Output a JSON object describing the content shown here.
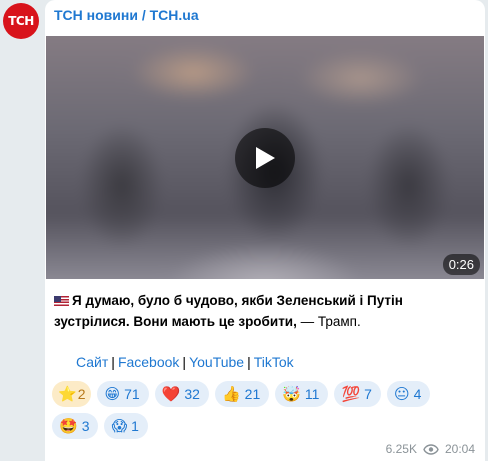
{
  "channel": {
    "avatar_text": "ТСН",
    "name": "ТСН новини / TCH.ua"
  },
  "video": {
    "duration": "0:26"
  },
  "post": {
    "text_bold": "Я думаю, було б чудово, якби Зеленський і Путін зустрілися. Вони мають це зробити,",
    "text_rest": " — Трамп."
  },
  "links": {
    "site": "Сайт",
    "facebook": "Facebook",
    "youtube": "YouTube",
    "tiktok": "TikTok",
    "separator": "|"
  },
  "reactions": [
    {
      "icon": "⭐",
      "name": "star-reaction",
      "count": "2"
    },
    {
      "icon": "😁",
      "name": "grin-reaction",
      "count": "71"
    },
    {
      "icon": "❤️",
      "name": "heart-reaction",
      "count": "32"
    },
    {
      "icon": "👍",
      "name": "thumbs-up-reaction",
      "count": "21"
    },
    {
      "icon": "🤯",
      "name": "mind-blown-reaction",
      "count": "11"
    },
    {
      "icon": "💯",
      "name": "hundred-reaction",
      "count": "7"
    },
    {
      "icon": "😐",
      "name": "neutral-face-reaction",
      "count": "4"
    },
    {
      "icon": "🤩",
      "name": "star-struck-reaction",
      "count": "3"
    },
    {
      "icon": "😱",
      "name": "scream-reaction",
      "count": "1"
    }
  ],
  "meta": {
    "views": "6.25K",
    "time": "20:04"
  },
  "colors": {
    "accent": "#1f78d1",
    "avatar_bg": "#d8131b",
    "reaction_bg": "#e4eef9"
  }
}
